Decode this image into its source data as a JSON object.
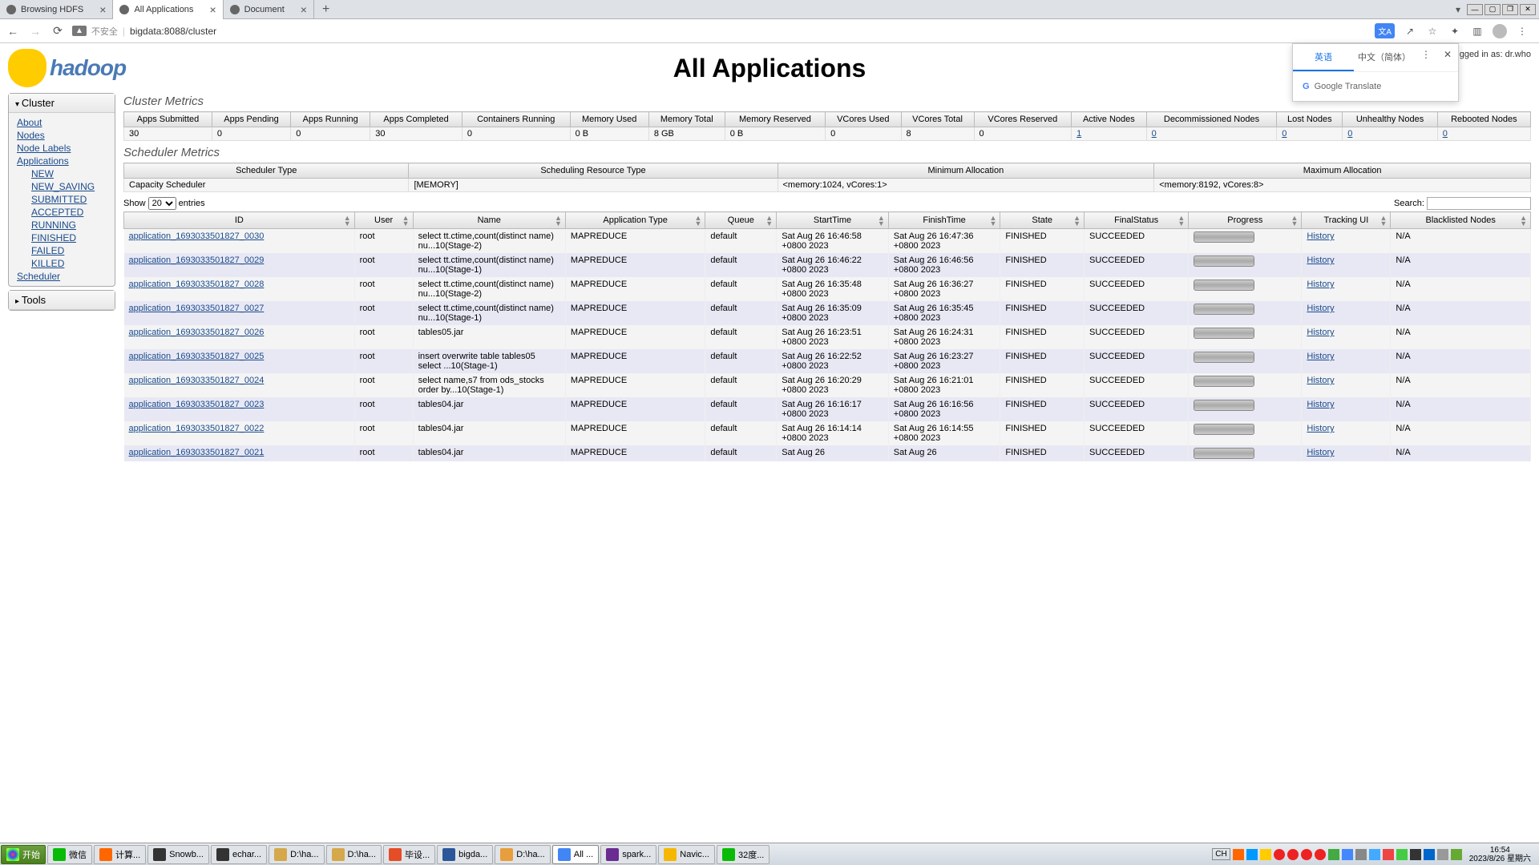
{
  "browser": {
    "tabs": [
      {
        "title": "Browsing HDFS"
      },
      {
        "title": "All Applications"
      },
      {
        "title": "Document"
      }
    ],
    "url_warning": "不安全",
    "url": "bigdata:8088/cluster"
  },
  "translate": {
    "tab_en": "英语",
    "tab_zh": "中文（简体）",
    "provider": "Google Translate"
  },
  "header": {
    "logo_text": "hadoop",
    "title": "All Applications",
    "logged_in": "gged in as: dr.who"
  },
  "sidebar": {
    "cluster": {
      "title": "Cluster",
      "links": [
        "About",
        "Nodes",
        "Node Labels",
        "Applications"
      ],
      "app_states": [
        "NEW",
        "NEW_SAVING",
        "SUBMITTED",
        "ACCEPTED",
        "RUNNING",
        "FINISHED",
        "FAILED",
        "KILLED"
      ],
      "scheduler": "Scheduler"
    },
    "tools": {
      "title": "Tools"
    }
  },
  "cluster_metrics": {
    "title": "Cluster Metrics",
    "headers": [
      "Apps Submitted",
      "Apps Pending",
      "Apps Running",
      "Apps Completed",
      "Containers Running",
      "Memory Used",
      "Memory Total",
      "Memory Reserved",
      "VCores Used",
      "VCores Total",
      "VCores Reserved",
      "Active Nodes",
      "Decommissioned Nodes",
      "Lost Nodes",
      "Unhealthy Nodes",
      "Rebooted Nodes"
    ],
    "values": [
      "30",
      "0",
      "0",
      "30",
      "0",
      "0 B",
      "8 GB",
      "0 B",
      "0",
      "8",
      "0",
      "1",
      "0",
      "0",
      "0",
      "0"
    ],
    "link_cols": [
      11,
      12,
      13,
      14,
      15
    ]
  },
  "scheduler_metrics": {
    "title": "Scheduler Metrics",
    "headers": [
      "Scheduler Type",
      "Scheduling Resource Type",
      "Minimum Allocation",
      "Maximum Allocation"
    ],
    "values": [
      "Capacity Scheduler",
      "[MEMORY]",
      "<memory:1024, vCores:1>",
      "<memory:8192, vCores:8>"
    ]
  },
  "datatable": {
    "show_label": "Show",
    "show_value": "20",
    "entries_label": "entries",
    "search_label": "Search:",
    "headers": [
      "ID",
      "User",
      "Name",
      "Application Type",
      "Queue",
      "StartTime",
      "FinishTime",
      "State",
      "FinalStatus",
      "Progress",
      "Tracking UI",
      "Blacklisted Nodes"
    ]
  },
  "apps": [
    {
      "id": "application_1693033501827_0030",
      "user": "root",
      "name": "select tt.ctime,count(distinct name) nu...10(Stage-2)",
      "type": "MAPREDUCE",
      "queue": "default",
      "start": "Sat Aug 26 16:46:58 +0800 2023",
      "finish": "Sat Aug 26 16:47:36 +0800 2023",
      "state": "FINISHED",
      "final": "SUCCEEDED",
      "tracking": "History",
      "blacklist": "N/A"
    },
    {
      "id": "application_1693033501827_0029",
      "user": "root",
      "name": "select tt.ctime,count(distinct name) nu...10(Stage-1)",
      "type": "MAPREDUCE",
      "queue": "default",
      "start": "Sat Aug 26 16:46:22 +0800 2023",
      "finish": "Sat Aug 26 16:46:56 +0800 2023",
      "state": "FINISHED",
      "final": "SUCCEEDED",
      "tracking": "History",
      "blacklist": "N/A"
    },
    {
      "id": "application_1693033501827_0028",
      "user": "root",
      "name": "select tt.ctime,count(distinct name) nu...10(Stage-2)",
      "type": "MAPREDUCE",
      "queue": "default",
      "start": "Sat Aug 26 16:35:48 +0800 2023",
      "finish": "Sat Aug 26 16:36:27 +0800 2023",
      "state": "FINISHED",
      "final": "SUCCEEDED",
      "tracking": "History",
      "blacklist": "N/A"
    },
    {
      "id": "application_1693033501827_0027",
      "user": "root",
      "name": "select tt.ctime,count(distinct name) nu...10(Stage-1)",
      "type": "MAPREDUCE",
      "queue": "default",
      "start": "Sat Aug 26 16:35:09 +0800 2023",
      "finish": "Sat Aug 26 16:35:45 +0800 2023",
      "state": "FINISHED",
      "final": "SUCCEEDED",
      "tracking": "History",
      "blacklist": "N/A"
    },
    {
      "id": "application_1693033501827_0026",
      "user": "root",
      "name": "tables05.jar",
      "type": "MAPREDUCE",
      "queue": "default",
      "start": "Sat Aug 26 16:23:51 +0800 2023",
      "finish": "Sat Aug 26 16:24:31 +0800 2023",
      "state": "FINISHED",
      "final": "SUCCEEDED",
      "tracking": "History",
      "blacklist": "N/A"
    },
    {
      "id": "application_1693033501827_0025",
      "user": "root",
      "name": "insert overwrite table tables05 select ...10(Stage-1)",
      "type": "MAPREDUCE",
      "queue": "default",
      "start": "Sat Aug 26 16:22:52 +0800 2023",
      "finish": "Sat Aug 26 16:23:27 +0800 2023",
      "state": "FINISHED",
      "final": "SUCCEEDED",
      "tracking": "History",
      "blacklist": "N/A"
    },
    {
      "id": "application_1693033501827_0024",
      "user": "root",
      "name": "select name,s7 from ods_stocks order by...10(Stage-1)",
      "type": "MAPREDUCE",
      "queue": "default",
      "start": "Sat Aug 26 16:20:29 +0800 2023",
      "finish": "Sat Aug 26 16:21:01 +0800 2023",
      "state": "FINISHED",
      "final": "SUCCEEDED",
      "tracking": "History",
      "blacklist": "N/A"
    },
    {
      "id": "application_1693033501827_0023",
      "user": "root",
      "name": "tables04.jar",
      "type": "MAPREDUCE",
      "queue": "default",
      "start": "Sat Aug 26 16:16:17 +0800 2023",
      "finish": "Sat Aug 26 16:16:56 +0800 2023",
      "state": "FINISHED",
      "final": "SUCCEEDED",
      "tracking": "History",
      "blacklist": "N/A"
    },
    {
      "id": "application_1693033501827_0022",
      "user": "root",
      "name": "tables04.jar",
      "type": "MAPREDUCE",
      "queue": "default",
      "start": "Sat Aug 26 16:14:14 +0800 2023",
      "finish": "Sat Aug 26 16:14:55 +0800 2023",
      "state": "FINISHED",
      "final": "SUCCEEDED",
      "tracking": "History",
      "blacklist": "N/A"
    },
    {
      "id": "application_1693033501827_0021",
      "user": "root",
      "name": "tables04.jar",
      "type": "MAPREDUCE",
      "queue": "default",
      "start": "Sat Aug 26",
      "finish": "Sat Aug 26",
      "state": "FINISHED",
      "final": "SUCCEEDED",
      "tracking": "History",
      "blacklist": "N/A"
    }
  ],
  "taskbar": {
    "start": "开始",
    "items": [
      {
        "label": "微信",
        "color": "#09bb07"
      },
      {
        "label": "计算...",
        "color": "#ff6600"
      },
      {
        "label": "Snowb...",
        "color": "#333"
      },
      {
        "label": "echar...",
        "color": "#333"
      },
      {
        "label": "D:\\ha...",
        "color": "#d4a84b"
      },
      {
        "label": "D:\\ha...",
        "color": "#d4a84b"
      },
      {
        "label": "毕设...",
        "color": "#e44d26"
      },
      {
        "label": "bigda...",
        "color": "#2b579a"
      },
      {
        "label": "D:\\ha...",
        "color": "#e89e3c"
      },
      {
        "label": "All ...",
        "color": "#4285f4",
        "active": true
      },
      {
        "label": "spark...",
        "color": "#6a2c91"
      },
      {
        "label": "Navic...",
        "color": "#f5b700"
      },
      {
        "label": "32度...",
        "color": "#09bb07"
      }
    ],
    "ime": "CH",
    "clock_time": "16:54",
    "clock_date": "2023/8/26",
    "clock_day": "星期六"
  }
}
